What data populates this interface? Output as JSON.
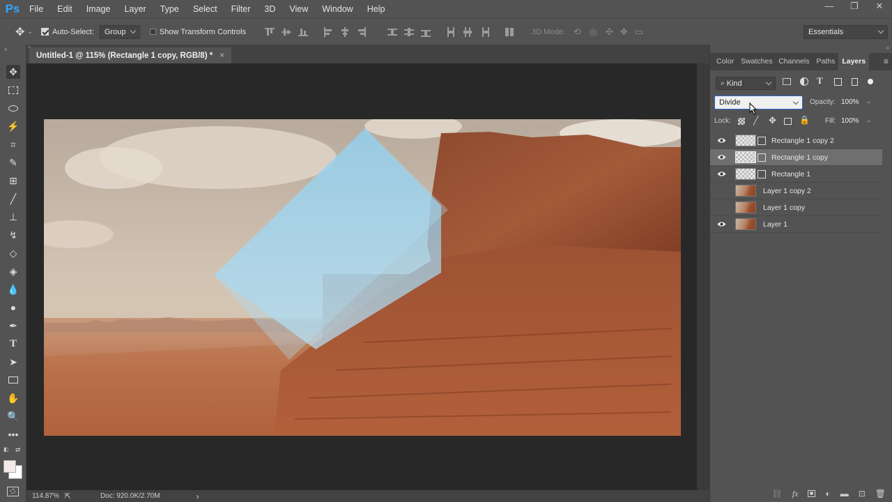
{
  "menu": {
    "items": [
      "File",
      "Edit",
      "Image",
      "Layer",
      "Type",
      "Select",
      "Filter",
      "3D",
      "View",
      "Window",
      "Help"
    ]
  },
  "options": {
    "auto_select": "Auto-Select:",
    "group_value": "Group",
    "show_transform": "Show Transform Controls",
    "mode_3d": "3D Mode:",
    "workspace": "Essentials"
  },
  "document": {
    "tab_title": "Untitled-1 @ 115% (Rectangle 1 copy, RGB/8) *",
    "tab_close": "×"
  },
  "status": {
    "zoom": "114.87%",
    "doc": "Doc: 920.0K/2.70M",
    "arrow": "›"
  },
  "panel": {
    "tabs": [
      "Color",
      "Swatches",
      "Channels",
      "Paths",
      "Layers"
    ],
    "active_tab": "Layers",
    "filter": "Kind",
    "blend_mode": "Divide",
    "opacity_label": "Opacity:",
    "opacity_value": "100%",
    "lock_label": "Lock:",
    "fill_label": "Fill:",
    "fill_value": "100%"
  },
  "layers": [
    {
      "name": "Rectangle 1  copy 2",
      "visible": true,
      "kind": "shape",
      "selected": false
    },
    {
      "name": "Rectangle 1  copy",
      "visible": true,
      "kind": "shape",
      "selected": true
    },
    {
      "name": "Rectangle 1",
      "visible": true,
      "kind": "shape",
      "selected": false
    },
    {
      "name": "Layer 1 copy 2",
      "visible": false,
      "kind": "pixel",
      "selected": false
    },
    {
      "name": "Layer 1 copy",
      "visible": false,
      "kind": "pixel",
      "selected": false
    },
    {
      "name": "Layer 1",
      "visible": true,
      "kind": "pixel",
      "selected": false
    }
  ],
  "colors": {
    "accent": "#31a8ff",
    "panel": "#535353",
    "dark": "#282828"
  }
}
